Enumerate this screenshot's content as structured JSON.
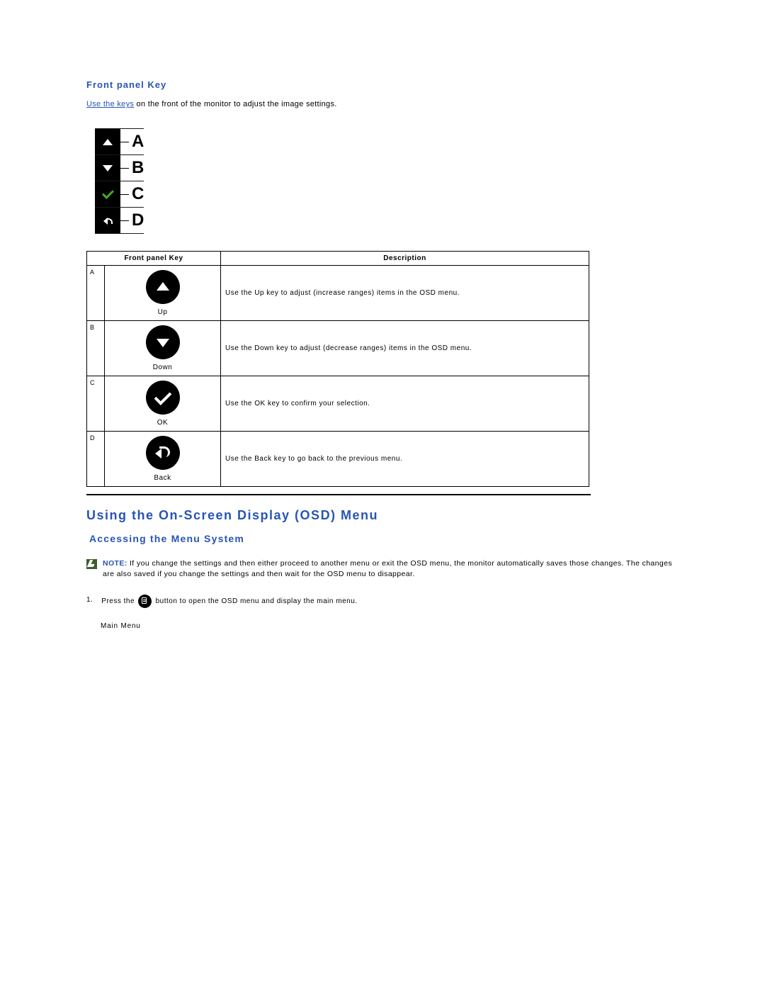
{
  "section1": {
    "title": "Front panel Key",
    "intro_link": "Use the keys",
    "intro_rest": " on the front of the monitor to adjust the image settings."
  },
  "panel": {
    "labels": [
      "A",
      "B",
      "C",
      "D"
    ]
  },
  "table": {
    "headers": {
      "col1": "Front panel Key",
      "col2": "Description"
    },
    "rows": [
      {
        "idx": "A",
        "name": "Up",
        "desc": "Use the Up key to adjust (increase ranges) items in the OSD menu."
      },
      {
        "idx": "B",
        "name": "Down",
        "desc": "Use the Down key to adjust (decrease ranges) items in the OSD menu."
      },
      {
        "idx": "C",
        "name": "OK",
        "desc": "Use the OK key to confirm your selection."
      },
      {
        "idx": "D",
        "name": "Back",
        "desc": "Use the Back key to go back to the previous menu."
      }
    ]
  },
  "section2": {
    "h2": "Using the On-Screen Display (OSD) Menu",
    "h3": "Accessing the Menu System",
    "note_label": "NOTE:",
    "note_text": " If you change the settings and then either proceed to another menu or exit the OSD menu, the monitor automatically saves those changes. The changes are also saved if you change the settings and then wait for the OSD menu to disappear.",
    "step_num": "1.",
    "step_pre": "Press the ",
    "step_post": " button to open the OSD menu and display the main menu.",
    "main_menu": "Main Menu"
  }
}
